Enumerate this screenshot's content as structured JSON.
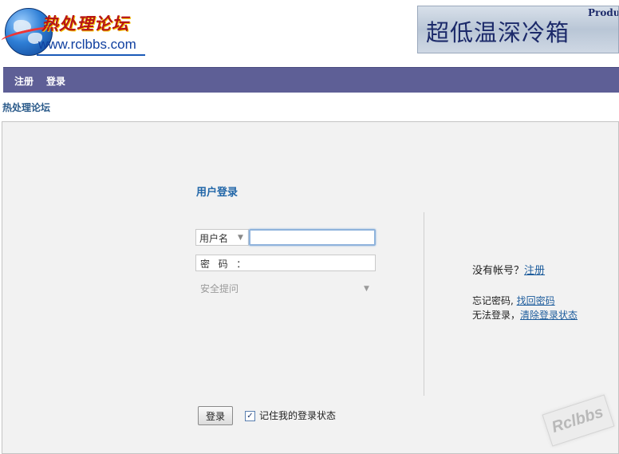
{
  "header": {
    "logo_title": "热处理论坛",
    "logo_url": "www.rclbbs.com",
    "banner_text": "超低温深冷箱",
    "banner_corner": "Produ"
  },
  "nav": {
    "register": "注册",
    "login": "登录"
  },
  "breadcrumb": "热处理论坛",
  "login_form": {
    "title": "用户登录",
    "username_select": "用户名",
    "username_value": "",
    "password_label": "密  码  ：",
    "password_value": "",
    "security_question": "安全提问",
    "submit_label": "登录",
    "remember_label": "记住我的登录状态",
    "remember_checked": true
  },
  "side": {
    "no_account": "没有帐号？",
    "register_link": "注册",
    "forgot_prefix": "忘记密码, ",
    "forgot_link": "找回密码",
    "cant_login_prefix": "无法登录，",
    "clear_link": "清除登录状态"
  },
  "watermark": "Rclbbs",
  "colors": {
    "navbar": "#5e5f96",
    "link": "#1d5c9c",
    "title": "#2166a8"
  }
}
